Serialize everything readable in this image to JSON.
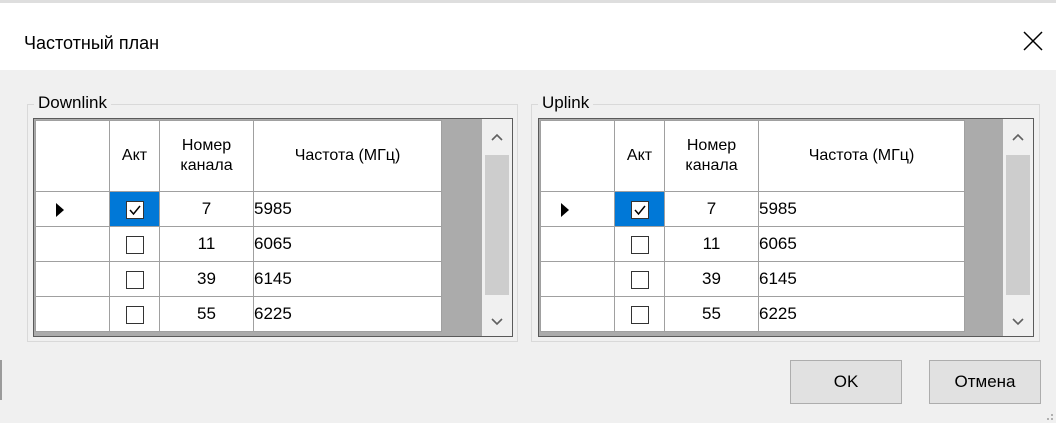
{
  "window": {
    "title": "Частотный план"
  },
  "downlink": {
    "legend": "Downlink",
    "columns": {
      "active": "Акт",
      "channel": "Номер канала",
      "frequency": "Частота (МГц)"
    },
    "rows": [
      {
        "active": true,
        "channel": "7",
        "frequency": "5985"
      },
      {
        "active": false,
        "channel": "11",
        "frequency": "6065"
      },
      {
        "active": false,
        "channel": "39",
        "frequency": "6145"
      },
      {
        "active": false,
        "channel": "55",
        "frequency": "6225"
      }
    ]
  },
  "uplink": {
    "legend": "Uplink",
    "columns": {
      "active": "Акт",
      "channel": "Номер канала",
      "frequency": "Частота (МГц)"
    },
    "rows": [
      {
        "active": true,
        "channel": "7",
        "frequency": "5985"
      },
      {
        "active": false,
        "channel": "11",
        "frequency": "6065"
      },
      {
        "active": false,
        "channel": "39",
        "frequency": "6145"
      },
      {
        "active": false,
        "channel": "55",
        "frequency": "6225"
      }
    ]
  },
  "buttons": {
    "ok": "OK",
    "cancel": "Отмена"
  },
  "colors": {
    "selection": "#0078d7",
    "background": "#f0f0f0"
  },
  "icons": {
    "close": "close-icon",
    "row_pointer": "current-row-arrow-icon",
    "scroll_up": "chevron-up-icon",
    "scroll_down": "chevron-down-icon"
  }
}
